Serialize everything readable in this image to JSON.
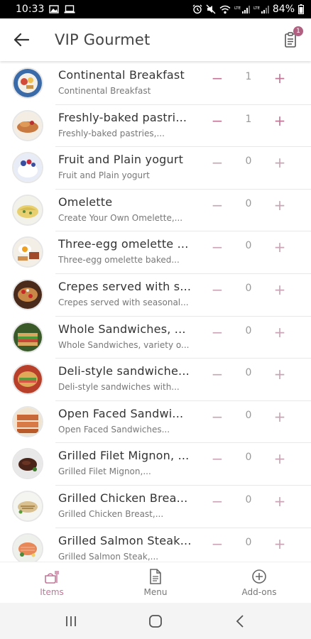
{
  "status_bar": {
    "time": "10:33",
    "battery": "84%",
    "icons": [
      "image-icon",
      "laptop-icon",
      "alarm-icon",
      "mute-icon",
      "wifi-icon",
      "lte-signal-icon",
      "lte-signal-icon",
      "battery-icon"
    ],
    "signal_label": "LTE"
  },
  "header": {
    "title": "VIP Gourmet",
    "back_icon": "arrow-left-icon",
    "cart_icon": "order-clipboard-icon",
    "cart_count": "1"
  },
  "colors": {
    "accent": "#c07898",
    "accent_light": "#c9a5b5",
    "badge": "#b06080",
    "title_text": "#444444",
    "item_text": "#333333",
    "desc_text": "#777777"
  },
  "items": [
    {
      "name": "Continental Breakfast",
      "desc": "Continental Breakfast",
      "qty": "1",
      "image": "continental-breakfast-photo"
    },
    {
      "name": "Freshly-baked pastri...",
      "desc": "Freshly-baked pastries,...",
      "qty": "1",
      "image": "pastries-photo"
    },
    {
      "name": "Fruit and Plain yogurt",
      "desc": "Fruit and Plain yogurt",
      "qty": "0",
      "image": "yogurt-photo"
    },
    {
      "name": "Omelette",
      "desc": "Create Your Own Omelette,...",
      "qty": "0",
      "image": "omelette-photo"
    },
    {
      "name": "Three-egg omelette ...",
      "desc": "Three-egg omelette baked...",
      "qty": "0",
      "image": "three-egg-omelette-photo"
    },
    {
      "name": "Crepes served with s...",
      "desc": "Crepes served with seasonal...",
      "qty": "0",
      "image": "crepes-photo"
    },
    {
      "name": "Whole Sandwiches, ...",
      "desc": "Whole Sandwiches, variety o...",
      "qty": "0",
      "image": "whole-sandwiches-photo"
    },
    {
      "name": "Deli-style sandwiche...",
      "desc": "Deli-style sandwiches with...",
      "qty": "0",
      "image": "deli-sandwiches-photo"
    },
    {
      "name": "Open Faced Sandwi...",
      "desc": "Open Faced Sandwiches...",
      "qty": "0",
      "image": "open-faced-sandwiches-photo"
    },
    {
      "name": "Grilled Filet Mignon, ...",
      "desc": "Grilled Filet Mignon,...",
      "qty": "0",
      "image": "filet-mignon-photo"
    },
    {
      "name": "Grilled Chicken Brea...",
      "desc": "Grilled Chicken Breast,...",
      "qty": "0",
      "image": "chicken-breast-photo"
    },
    {
      "name": "Grilled Salmon Steak...",
      "desc": "Grilled Salmon Steak,...",
      "qty": "0",
      "image": "salmon-steak-photo"
    }
  ],
  "controls": {
    "minus": "−",
    "plus": "+"
  },
  "bottom_nav": [
    {
      "label": "Items",
      "icon": "food-items-icon",
      "active": true
    },
    {
      "label": "Menu",
      "icon": "document-icon",
      "active": false
    },
    {
      "label": "Add-ons",
      "icon": "add-circle-icon",
      "active": false
    }
  ],
  "system_nav": {
    "recents_icon": "recents-icon",
    "home_icon": "home-icon",
    "back_icon": "back-chevron-icon"
  }
}
